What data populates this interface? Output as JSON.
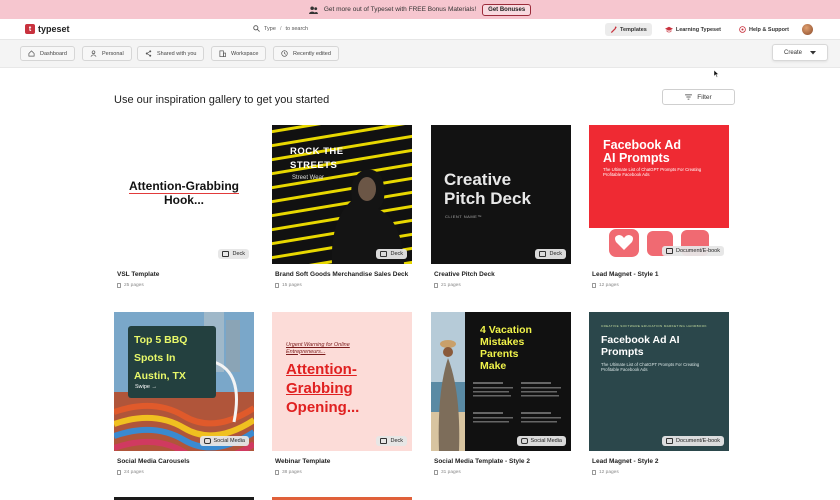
{
  "banner": {
    "text": "Get more out of Typeset with FREE Bonus Materials!",
    "button": "Get Bonuses"
  },
  "header": {
    "logo": "typeset",
    "search_placeholder": "Type",
    "search_key": "/",
    "search_suffix": "to search",
    "links": [
      {
        "label": "Templates",
        "icon": "templates-icon",
        "active": true
      },
      {
        "label": "Learning Typeset",
        "icon": "graduation-cap-icon",
        "active": false
      },
      {
        "label": "Help & Support",
        "icon": "help-circle-icon",
        "active": false
      }
    ]
  },
  "subnav": {
    "items": [
      {
        "label": "Dashboard",
        "icon": "home-icon"
      },
      {
        "label": "Personal",
        "icon": "user-icon"
      },
      {
        "label": "Shared with you",
        "icon": "share-icon"
      },
      {
        "label": "Workspace",
        "icon": "building-icon"
      },
      {
        "label": "Recently edited",
        "icon": "clock-icon"
      }
    ],
    "create_label": "Create"
  },
  "gallery": {
    "heading": "Use our inspiration gallery to get you started",
    "filter_label": "Filter",
    "cards": [
      {
        "title": "VSL Template",
        "pages": "25 pages",
        "type": "Deck",
        "art": {
          "line1": "Attention-Grabbing",
          "line2": "Hook..."
        }
      },
      {
        "title": "Brand Soft Goods Merchandise Sales Deck",
        "pages": "15 pages",
        "type": "Deck",
        "art": {
          "line1": "ROCK THE",
          "line2": "STREETS",
          "sub": "Street Wear"
        }
      },
      {
        "title": "Creative Pitch Deck",
        "pages": "21 pages",
        "type": "Deck",
        "art": {
          "line1": "Creative",
          "line2": "Pitch Deck",
          "sub": "CLIENT NAME™"
        }
      },
      {
        "title": "Lead Magnet - Style 1",
        "pages": "12 pages",
        "type": "Document/E-book",
        "art": {
          "line1": "Facebook Ad",
          "line2": "AI Prompts",
          "sub": "The Ultimate List of ChatGPT Prompts For Creating Profitable Facebook Ads"
        }
      },
      {
        "title": "Social Media Carousels",
        "pages": "24 pages",
        "type": "Social Media",
        "art": {
          "line1": "Top 5 BBQ",
          "line2": "Spots In",
          "line3": "Austin, TX",
          "sub": "Swipe →"
        }
      },
      {
        "title": "Webinar Template",
        "pages": "38 pages",
        "type": "Deck",
        "art": {
          "pre": "Urgent Warning for Online Entrepreneurs...",
          "line1": "Attention-",
          "line2": "Grabbing",
          "line3": "Opening..."
        }
      },
      {
        "title": "Social Media Template - Style 2",
        "pages": "31 pages",
        "type": "Social Media",
        "art": {
          "line1": "4 Vacation",
          "line2": "Mistakes",
          "line3": "Parents",
          "line4": "Make"
        }
      },
      {
        "title": "Lead Magnet - Style 2",
        "pages": "12 pages",
        "type": "Document/E-book",
        "art": {
          "tag": "CREATIVE SOFTWARE EDUCATION MARKETING HANDBOOK",
          "line1": "Facebook Ad AI",
          "line2": "Prompts",
          "sub": "The Ultimate List of ChatGPT Prompts For Creating Profitable Facebook Ads"
        }
      }
    ]
  },
  "colors": {
    "brand": "#c8323e",
    "banner_bg": "#f6c6cf",
    "subnav_bg": "#f4f4f4"
  }
}
